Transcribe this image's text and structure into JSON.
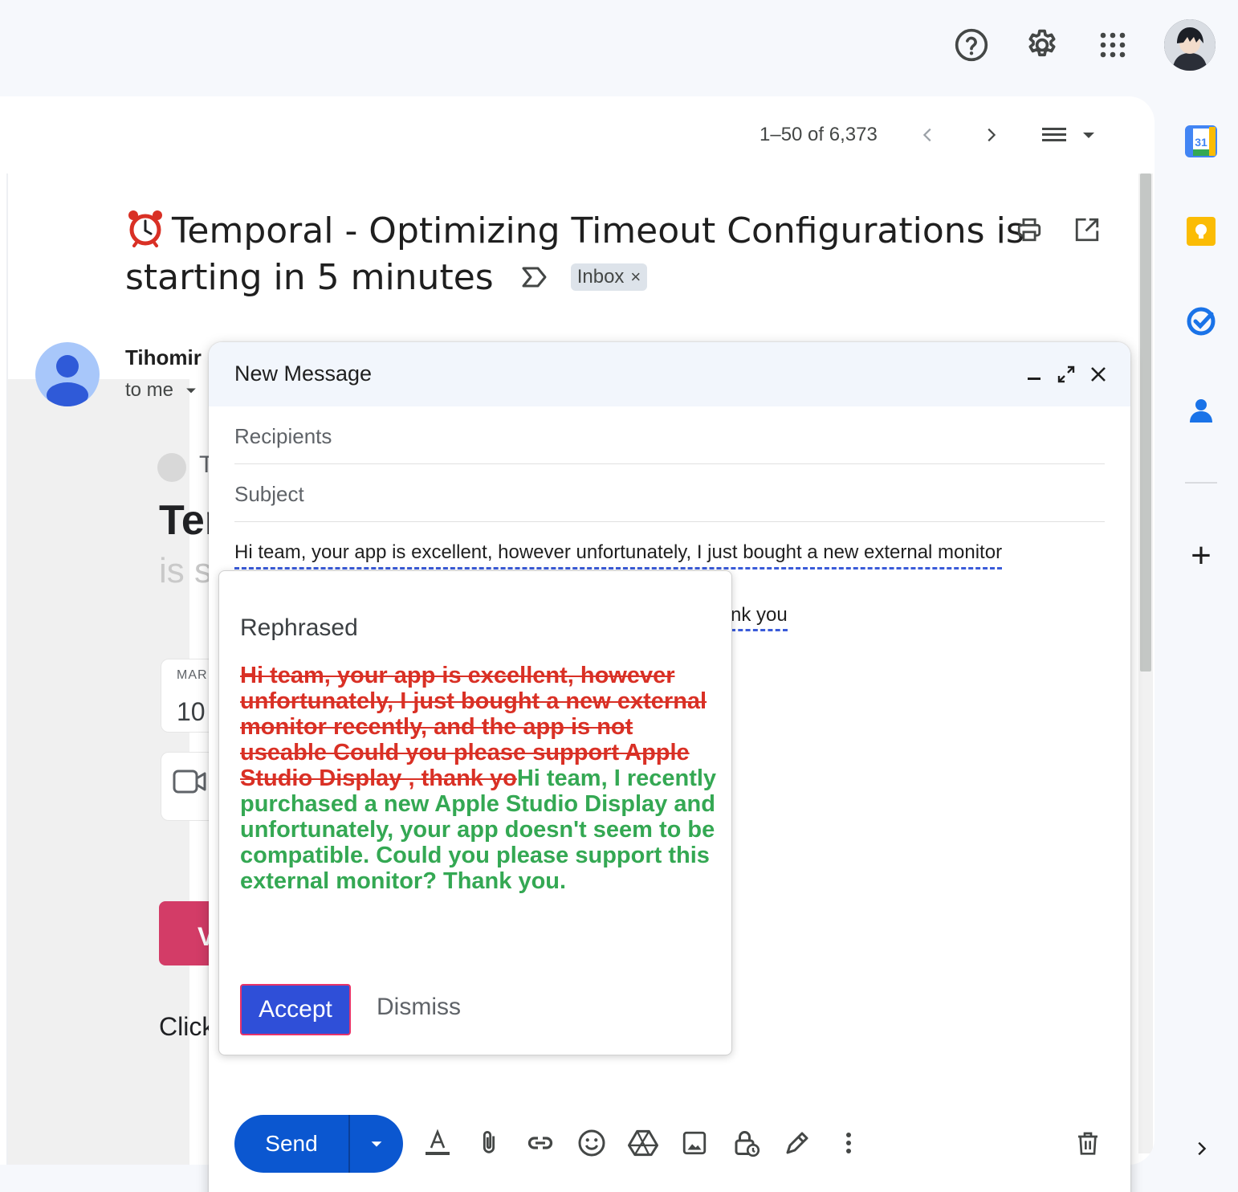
{
  "topbar": {
    "help_icon": "help-icon",
    "settings_icon": "gear-icon",
    "apps_icon": "apps-grid-icon",
    "avatar": "account-avatar"
  },
  "toolbar": {
    "pagination": "1–50 of 6,373"
  },
  "email": {
    "subject_line1": "Temporal - Optimizing Timeout Configurations is",
    "subject_line2": "starting in 5 minutes",
    "label_chip": "Inbox",
    "label_chip_close": "×",
    "sender_name": "Tihomir",
    "recipient": "to me",
    "body_fragment_t": "T",
    "body_fragment_title": "Ter",
    "body_fragment_sub": "is s",
    "date_month": "MAR",
    "date_day": "10",
    "join_fragment": "V",
    "click_fragment": "Click"
  },
  "compose": {
    "title": "New Message",
    "recipients_placeholder": "Recipients",
    "subject_placeholder": "Subject",
    "body_line1": "Hi team, your app is excellent, however unfortunately, I just bought a new external monitor",
    "body_line2_fragment": "nk you",
    "send_label": "Send"
  },
  "suggestion": {
    "heading": "Rephrased",
    "removed_text": "Hi team, your app is excellent, however unfortunately, I just bought a new external monitor recently, and the app is not useable Could you please support Apple Studio Display , thank yo",
    "added_text": "Hi team, I recently purchased a new Apple Studio Display and unfortunately, your app doesn't seem to be compatible. Could you please support this external monitor? Thank you.",
    "accept_label": "Accept",
    "dismiss_label": "Dismiss"
  },
  "side_panel": {
    "calendar_day": "31",
    "add_label": "+"
  },
  "colors": {
    "accent_blue": "#0b57d0",
    "removed_red": "#d93025",
    "added_green": "#34a853",
    "accept_bg": "#2f4fd8"
  }
}
